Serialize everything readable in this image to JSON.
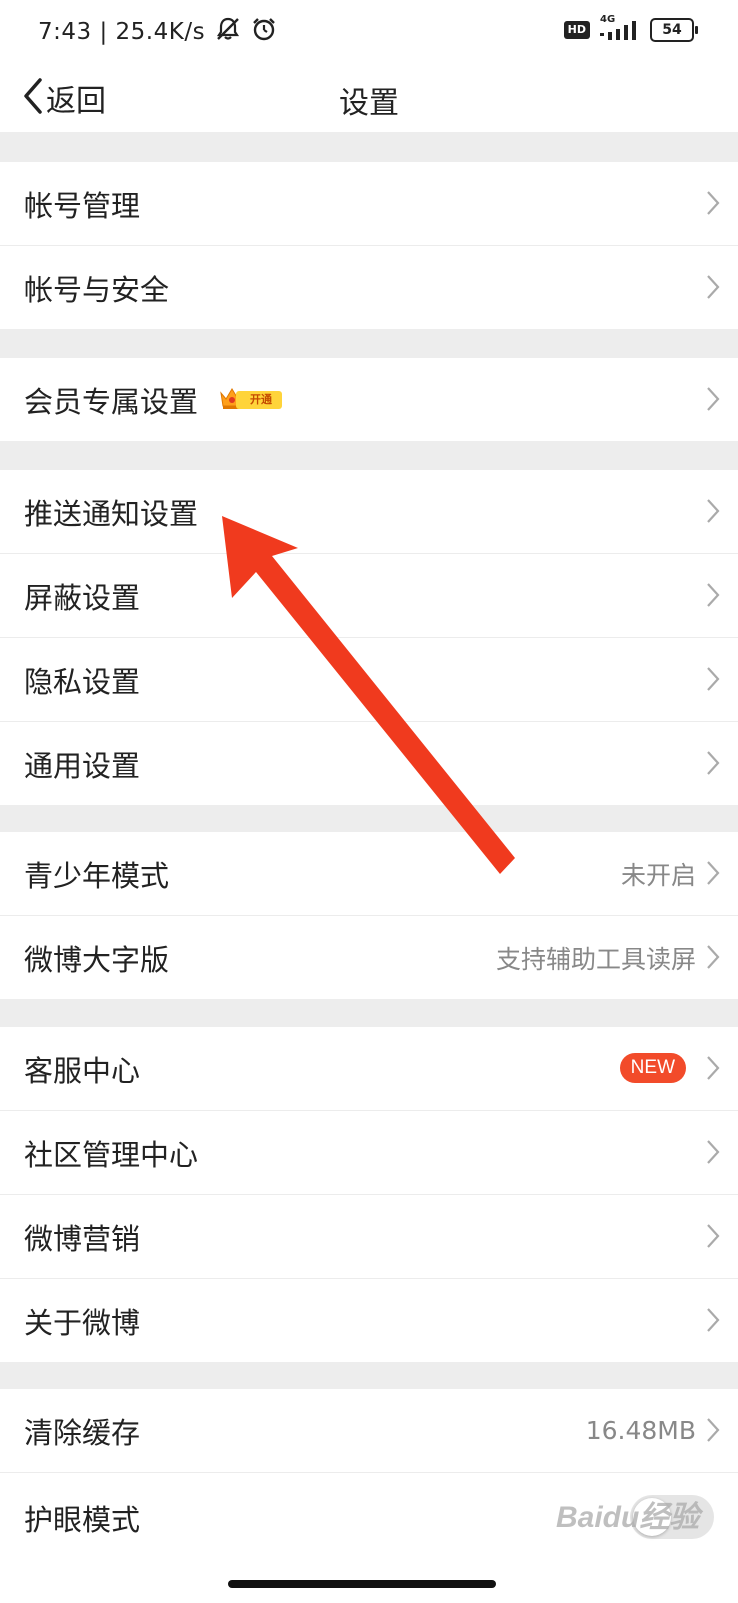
{
  "status_bar": {
    "time_speed": "7:43 | 25.4K/s",
    "hd": "HD",
    "network": "4G",
    "battery": "54"
  },
  "nav": {
    "back_label": "返回",
    "title": "设置"
  },
  "groups": [
    {
      "items": [
        {
          "title": "帐号管理"
        },
        {
          "title": "帐号与安全"
        }
      ]
    },
    {
      "items": [
        {
          "title": "会员专属设置",
          "badge": "开通"
        }
      ]
    },
    {
      "items": [
        {
          "title": "推送通知设置"
        },
        {
          "title": "屏蔽设置"
        },
        {
          "title": "隐私设置"
        },
        {
          "title": "通用设置"
        }
      ]
    },
    {
      "items": [
        {
          "title": "青少年模式",
          "value": "未开启"
        },
        {
          "title": "微博大字版",
          "value": "支持辅助工具读屏"
        }
      ]
    },
    {
      "items": [
        {
          "title": "客服中心",
          "badge": "NEW"
        },
        {
          "title": "社区管理中心"
        },
        {
          "title": "微博营销"
        },
        {
          "title": "关于微博"
        }
      ]
    },
    {
      "items": [
        {
          "title": "清除缓存",
          "value": "16.48MB"
        },
        {
          "title": "护眼模式",
          "toggle": false
        }
      ]
    }
  ],
  "colors": {
    "accent_red": "#f24b2a",
    "crown_yellow": "#ffd43a"
  },
  "watermark": "Baidu经验"
}
